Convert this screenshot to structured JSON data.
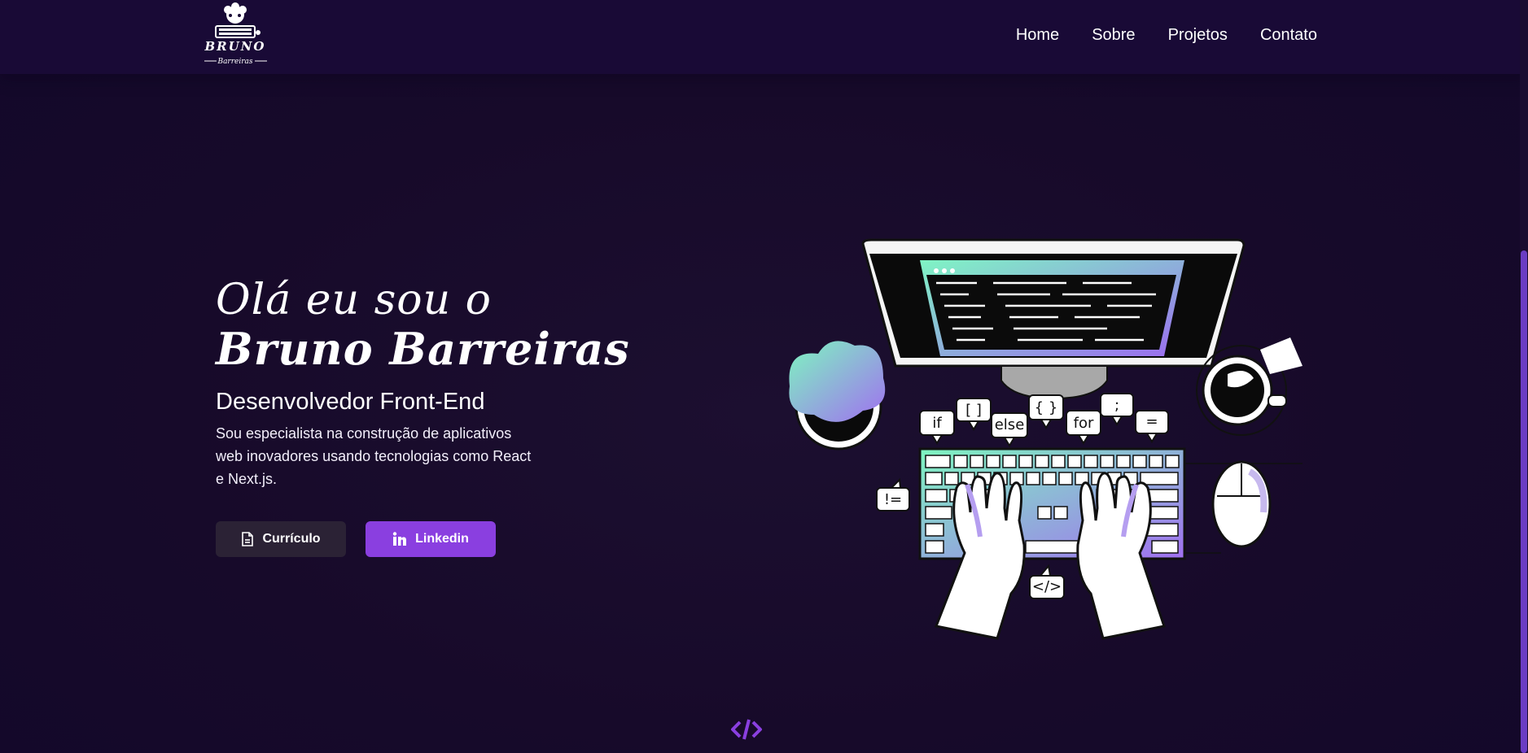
{
  "nav": {
    "logo_text": "BRUNO",
    "logo_subtext": "Barreiras",
    "links": [
      "Home",
      "Sobre",
      "Projetos",
      "Contato"
    ]
  },
  "hero": {
    "greeting": "Olá eu sou o",
    "name": "Bruno Barreiras",
    "role": "Desenvolvedor Front-End",
    "description": "Sou especialista na construção de aplicativos web inovadores usando tecnologias como React e Next.js.",
    "buttons": {
      "cv": "Currículo",
      "linkedin": "Linkedin"
    }
  },
  "illustration": {
    "bubbles": [
      "if",
      "[ ]",
      "else",
      "{ }",
      "for",
      ";",
      "=",
      "!=",
      "</>"
    ]
  },
  "colors": {
    "accent": "#8a3fe0",
    "nav_bg": "#190a36",
    "mint": "#86f0c4"
  },
  "icons": [
    "file-icon",
    "linkedin-icon",
    "code-icon"
  ]
}
